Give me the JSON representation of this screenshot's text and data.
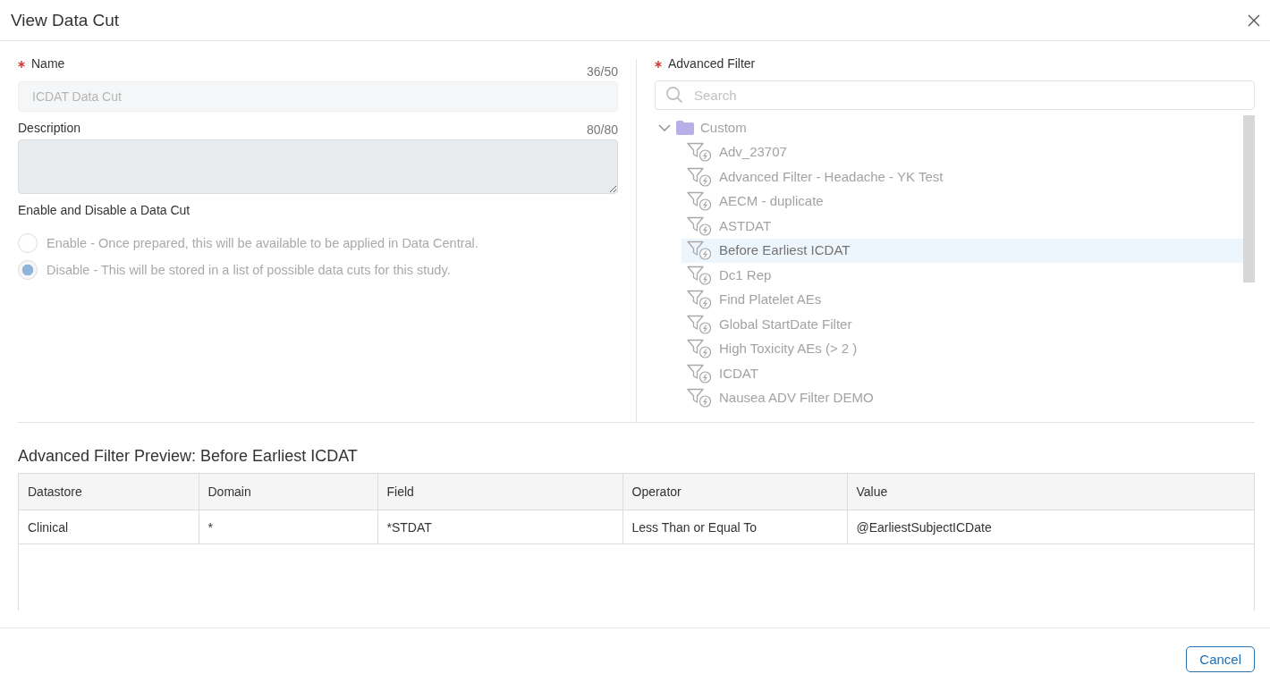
{
  "dialog": {
    "title": "View Data Cut"
  },
  "name_field": {
    "label": "Name",
    "required": true,
    "counter": "36/50",
    "value": "ICDAT Data Cut",
    "disabled": true
  },
  "description_field": {
    "label": "Description",
    "counter": "80/80",
    "disabled": true
  },
  "enable_disable": {
    "label": "Enable and Disable a Data Cut",
    "options": [
      {
        "label": "Enable - Once prepared, this will be available to be applied in Data Central.",
        "selected": false,
        "disabled": true
      },
      {
        "label": "Disable - This will be stored in a list of possible data cuts for this study.",
        "selected": true,
        "disabled": true
      }
    ]
  },
  "advanced_filter": {
    "label": "Advanced Filter",
    "required": true,
    "search": {
      "placeholder": "Search"
    },
    "tree": [
      {
        "label": "Custom",
        "kind": "folder",
        "expanded": true,
        "children": [
          {
            "label": "Adv_23707",
            "kind": "filter",
            "selected": false
          },
          {
            "label": "Advanced Filter - Headache - YK Test",
            "kind": "filter",
            "selected": false
          },
          {
            "label": "AECM - duplicate",
            "kind": "filter",
            "selected": false
          },
          {
            "label": "ASTDAT",
            "kind": "filter",
            "selected": false
          },
          {
            "label": "Before Earliest ICDAT",
            "kind": "filter",
            "selected": true
          },
          {
            "label": "Dc1 Rep",
            "kind": "filter",
            "selected": false
          },
          {
            "label": "Find Platelet AEs",
            "kind": "filter",
            "selected": false
          },
          {
            "label": "Global StartDate Filter",
            "kind": "filter",
            "selected": false
          },
          {
            "label": "High Toxicity AEs (> 2 )",
            "kind": "filter",
            "selected": false
          },
          {
            "label": "ICDAT",
            "kind": "filter",
            "selected": false
          },
          {
            "label": "Nausea ADV Filter DEMO",
            "kind": "filter",
            "selected": false
          }
        ]
      }
    ]
  },
  "preview": {
    "title": "Advanced Filter Preview: Before Earliest ICDAT",
    "table": {
      "columns": [
        "Datastore",
        "Domain",
        "Field",
        "Operator",
        "Value"
      ],
      "rows": [
        [
          "Clinical",
          "*",
          "*STDAT",
          "Less Than or Equal To",
          "@EarliestSubjectICDate"
        ]
      ]
    }
  },
  "footer": {
    "buttons": [
      {
        "label": "Cancel"
      }
    ]
  }
}
